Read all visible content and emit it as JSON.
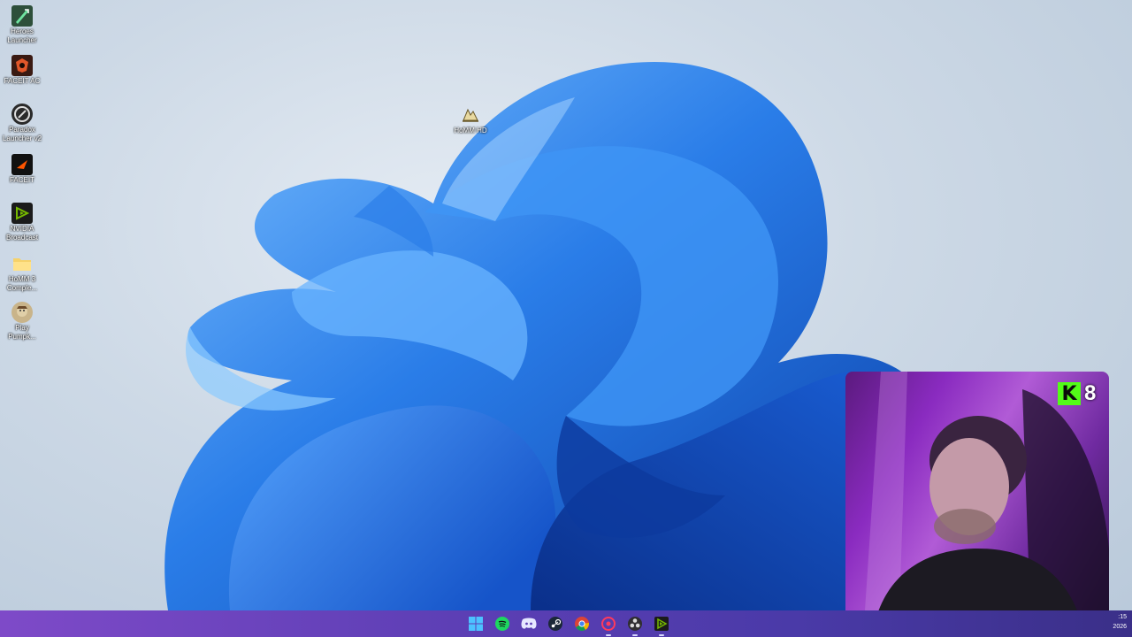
{
  "desktop": {
    "icons": [
      {
        "label": "Heroes\nLauncher",
        "icon": "heroes-launcher-icon"
      },
      {
        "label": "FACEIT AC",
        "icon": "faceit-ac-icon"
      },
      {
        "label": "Paradox\nLauncher v2",
        "icon": "paradox-launcher-icon"
      },
      {
        "label": "FACEIT",
        "icon": "faceit-icon"
      },
      {
        "label": "NVIDIA\nBroadcast",
        "icon": "nvidia-broadcast-icon"
      },
      {
        "label": "HoMM 3\nComple...",
        "icon": "folder-icon"
      },
      {
        "label": "Play\nPumpk...",
        "icon": "play-pumpkin-icon"
      },
      {
        "label": "HoMM HD",
        "icon": "homm-hd-icon"
      }
    ]
  },
  "overlay": {
    "kick_logo": "K",
    "viewer_count": "8",
    "accent": "#53fc18"
  },
  "taskbar": {
    "apps": [
      {
        "icon": "windows-start-icon",
        "running": false
      },
      {
        "icon": "spotify-icon",
        "running": false
      },
      {
        "icon": "discord-icon",
        "running": false
      },
      {
        "icon": "steam-icon",
        "running": false
      },
      {
        "icon": "chrome-icon",
        "running": false
      },
      {
        "icon": "app-red-icon",
        "running": true
      },
      {
        "icon": "obs-icon",
        "running": true
      },
      {
        "icon": "nvidia-broadcast-taskbar-icon",
        "running": true
      }
    ],
    "clock_time": ":15",
    "clock_date": "2026"
  },
  "colors": {
    "wallpaper_bloom": "#1e6fe0",
    "taskbar": "#5d3fb5"
  }
}
